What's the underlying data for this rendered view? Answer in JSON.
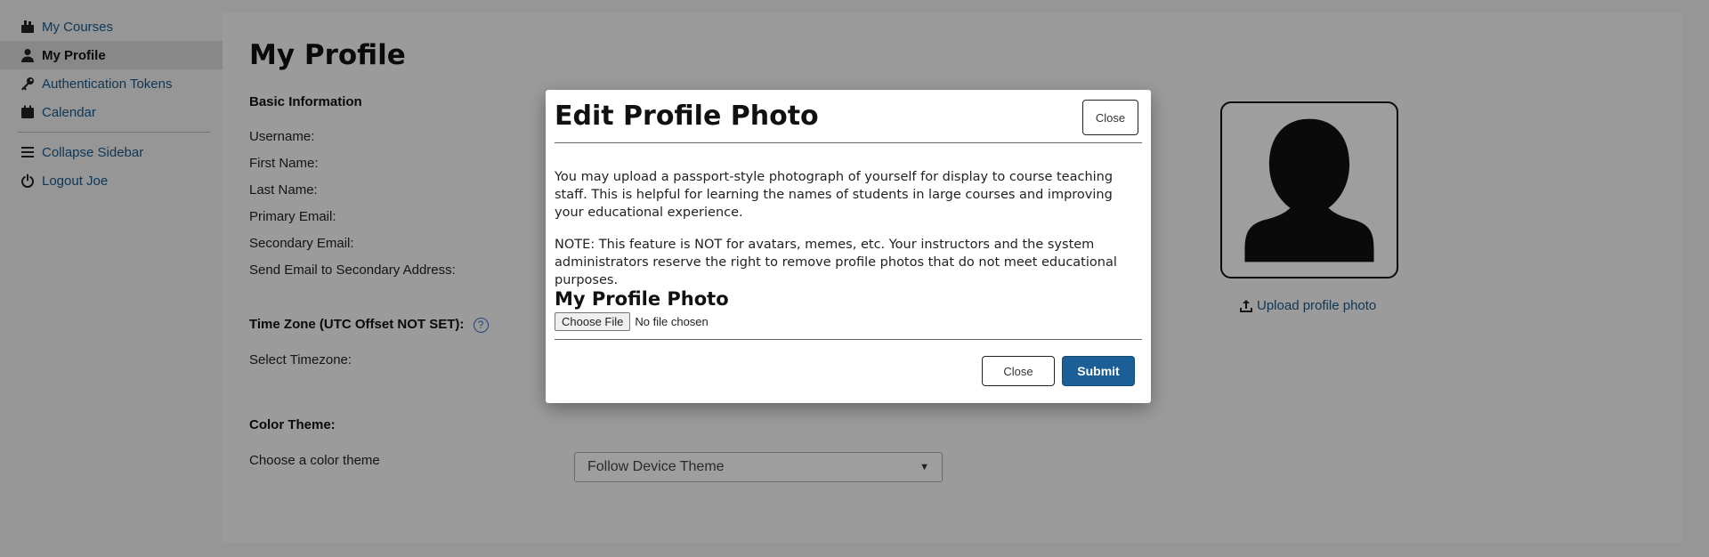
{
  "sidebar": {
    "items": [
      {
        "label": "My Courses",
        "icon": "courses-icon"
      },
      {
        "label": "My Profile",
        "icon": "user-icon"
      },
      {
        "label": "Authentication Tokens",
        "icon": "key-icon"
      },
      {
        "label": "Calendar",
        "icon": "calendar-icon"
      },
      {
        "label": "Collapse Sidebar",
        "icon": "menu-icon"
      },
      {
        "label": "Logout Joe",
        "icon": "power-icon"
      }
    ]
  },
  "profile": {
    "title": "My Profile",
    "basic_info": "Basic Information",
    "fields": [
      "Username:",
      "First Name:",
      "Last Name:",
      "Primary Email:",
      "Secondary Email:",
      "Send Email to Secondary Address:"
    ],
    "timezone_head": "Time Zone (UTC Offset NOT SET):",
    "help_glyph": "?",
    "select_timezone": "Select Timezone:",
    "color_theme_head": "Color Theme:",
    "choose_theme": "Choose a color theme",
    "theme_value": "Follow Device Theme",
    "upload_link": "Upload profile photo"
  },
  "modal": {
    "title": "Edit Profile Photo",
    "close_top": "Close",
    "para1": "You may upload a passport-style photograph of yourself for display to course teaching staff. This is helpful for learning the names of students in large courses and improving your educational experience.",
    "para2": "NOTE: This feature is NOT for avatars, memes, etc. Your instructors and the system administrators reserve the right to remove profile photos that do not meet educational purposes.",
    "subtitle": "My Profile Photo",
    "choose_file": "Choose File",
    "no_file": "No file chosen",
    "close_bottom": "Close",
    "submit": "Submit"
  },
  "colors": {
    "link": "#1b5a8c",
    "submit_bg": "#1c5f96",
    "overlay": "rgba(0,0,0,0.38)"
  }
}
